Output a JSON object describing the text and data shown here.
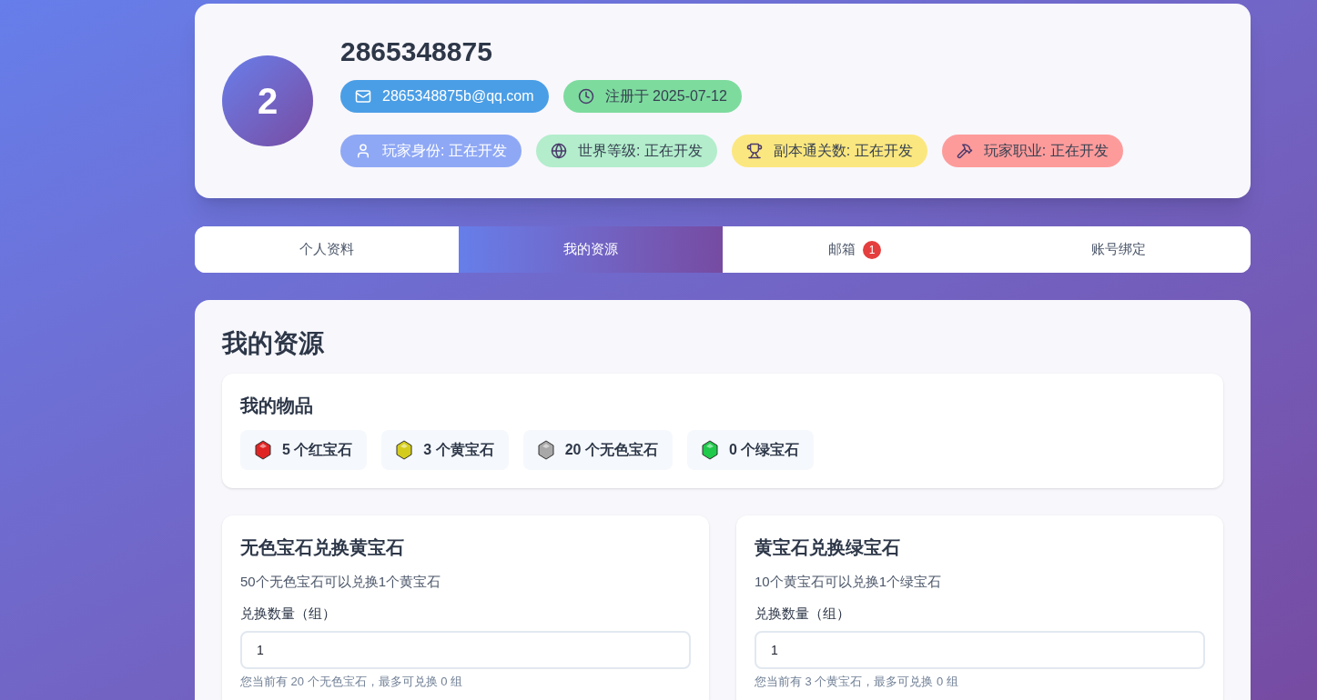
{
  "profile": {
    "avatar": "2",
    "name": "2865348875",
    "contact_badges": [
      {
        "kind": "mail",
        "text": "2865348875b@qq.com",
        "color": "#4a9ee6"
      },
      {
        "kind": "clock",
        "text": "注册于 2025-07-12",
        "color": "#7ddb9e"
      }
    ],
    "stat_badges": [
      {
        "kind": "user",
        "text": "玩家身份: 正在开发",
        "color": "#8fa8f5"
      },
      {
        "kind": "globe",
        "text": "世界等级: 正在开发",
        "color": "#b3edcc"
      },
      {
        "kind": "trophy",
        "text": "副本通关数: 正在开发",
        "color": "#fbe77f"
      },
      {
        "kind": "tools",
        "text": "玩家职业: 正在开发",
        "color": "#fd9b9b"
      }
    ]
  },
  "tabs": [
    {
      "label": "个人资料",
      "selected": false
    },
    {
      "label": "我的资源",
      "selected": true
    },
    {
      "label": "邮箱",
      "selected": false,
      "badge": "1"
    },
    {
      "label": "账号绑定",
      "selected": false
    }
  ],
  "resources": {
    "title": "我的资源",
    "items_title": "我的物品",
    "items": [
      {
        "text": "5 个红宝石",
        "color": "#e02424"
      },
      {
        "text": "3 个黄宝石",
        "color": "#d4cc1c"
      },
      {
        "text": "20 个无色宝石",
        "color": "#a8a8a8"
      },
      {
        "text": "0 个绿宝石",
        "color": "#1fc94a"
      }
    ],
    "exchanges": [
      {
        "title": "无色宝石兑换黄宝石",
        "description": "50个无色宝石可以兑换1个黄宝石",
        "label": "兑换数量（组）",
        "value": "1",
        "hint": "您当前有 20 个无色宝石，最多可兑换 0 组"
      },
      {
        "title": "黄宝石兑换绿宝石",
        "description": "10个黄宝石可以兑换1个绿宝石",
        "label": "兑换数量（组）",
        "value": "1",
        "hint": "您当前有 3 个黄宝石，最多可兑换 0 组"
      }
    ]
  }
}
